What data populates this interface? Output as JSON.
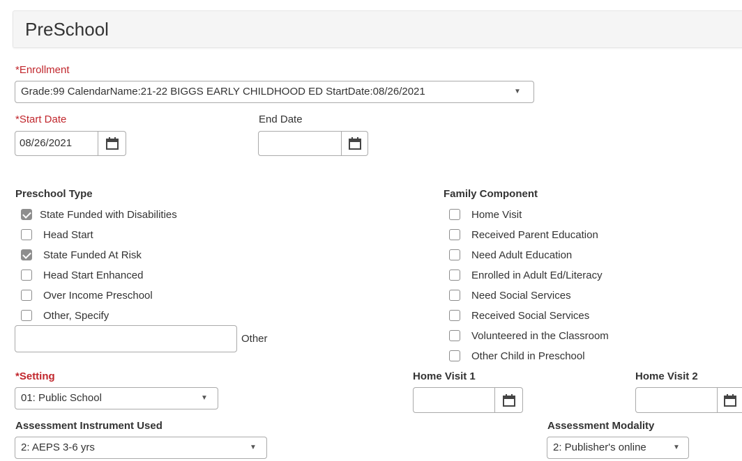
{
  "header": {
    "title": "PreSchool"
  },
  "enrollment": {
    "label": "*Enrollment",
    "value": "Grade:99 CalendarName:21-22 BIGGS EARLY CHILDHOOD ED StartDate:08/26/2021"
  },
  "start_date": {
    "label": "*Start Date",
    "value": "08/26/2021"
  },
  "end_date": {
    "label": "End Date",
    "value": ""
  },
  "preschool_type": {
    "heading": "Preschool Type",
    "items": [
      {
        "label": "State Funded with Disabilities",
        "checked": true
      },
      {
        "label": "Head Start",
        "checked": false
      },
      {
        "label": "State Funded At Risk",
        "checked": true
      },
      {
        "label": "Head Start Enhanced",
        "checked": false
      },
      {
        "label": "Over Income Preschool",
        "checked": false
      },
      {
        "label": "Other, Specify",
        "checked": false
      }
    ],
    "other_label": "Other",
    "other_value": ""
  },
  "family_component": {
    "heading": "Family Component",
    "items": [
      {
        "label": "Home Visit",
        "checked": false
      },
      {
        "label": "Received Parent Education",
        "checked": false
      },
      {
        "label": "Need Adult Education",
        "checked": false
      },
      {
        "label": "Enrolled in Adult Ed/Literacy",
        "checked": false
      },
      {
        "label": "Need Social Services",
        "checked": false
      },
      {
        "label": "Received Social Services",
        "checked": false
      },
      {
        "label": "Volunteered in the Classroom",
        "checked": false
      },
      {
        "label": "Other Child in Preschool",
        "checked": false
      }
    ]
  },
  "setting": {
    "asterisk": "*",
    "label": "Setting",
    "value": "01: Public School"
  },
  "home_visit_1": {
    "label": "Home Visit 1",
    "value": ""
  },
  "home_visit_2": {
    "label": "Home Visit 2",
    "value": ""
  },
  "assessment_instrument": {
    "label": "Assessment Instrument Used",
    "value": "2: AEPS 3-6 yrs"
  },
  "assessment_modality": {
    "label": "Assessment Modality",
    "value": "2: Publisher's online"
  },
  "colors": {
    "required": "#c1272d",
    "checkbox_checked": "#8e8e8e",
    "border": "#aaaaaa"
  },
  "icons": {
    "calendar": "calendar-icon",
    "caret": "caret-down-icon",
    "check": "check-icon"
  }
}
